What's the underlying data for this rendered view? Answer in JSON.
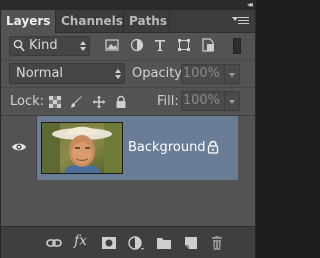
{
  "panel": {
    "collapse_glyph": "◂◂",
    "tabs": [
      {
        "label": "Layers",
        "active": true
      },
      {
        "label": "Channels",
        "active": false
      },
      {
        "label": "Paths",
        "active": false
      }
    ],
    "menu_icon": "panel-menu-icon"
  },
  "filter": {
    "kind_label": "Kind",
    "icons": [
      "pixel-filter-icon",
      "adjustment-filter-icon",
      "type-filter-icon",
      "shape-filter-icon",
      "smart-object-filter-icon"
    ]
  },
  "blend": {
    "mode": "Normal",
    "opacity_label": "Opacity:",
    "opacity_value": "100%",
    "fill_label": "Fill:",
    "fill_value": "100%"
  },
  "lock": {
    "label": "Lock:",
    "icons": [
      "lock-transparent-icon",
      "lock-image-icon",
      "lock-position-icon",
      "lock-all-icon"
    ]
  },
  "layers": [
    {
      "name": "Background",
      "visible": true,
      "locked": true,
      "selected": true
    }
  ],
  "footer": {
    "icons": [
      "link-layers-icon",
      "fx-icon",
      "add-mask-icon",
      "adjustment-layer-icon",
      "group-icon",
      "new-layer-icon",
      "delete-icon"
    ],
    "fx_label": "fx"
  },
  "colors": {
    "panel_bg": "#535353",
    "selection": "#6a7d97",
    "tab_bar": "#3c3c3c"
  }
}
